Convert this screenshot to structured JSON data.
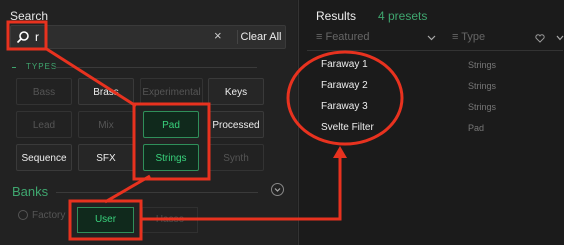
{
  "search": {
    "title": "Search",
    "query": "r",
    "clear_x": "×",
    "clear_all": "Clear All"
  },
  "types": {
    "label": "TYPES",
    "rows": [
      [
        "Bass",
        "Brass",
        "Experimental",
        "Keys"
      ],
      [
        "Lead",
        "Mix",
        "Pad",
        "Processed"
      ],
      [
        "Sequence",
        "SFX",
        "Strings",
        "Synth"
      ]
    ]
  },
  "banks": {
    "label": "Banks",
    "factory": "Factory",
    "user": "User",
    "faded": "Hasso"
  },
  "results": {
    "title": "Results",
    "count": "4 presets",
    "col_featured": "≡ Featured",
    "col_type": "≡ Type",
    "rows": [
      {
        "name": "Faraway 1",
        "type": "Strings"
      },
      {
        "name": "Faraway 2",
        "type": "Strings"
      },
      {
        "name": "Faraway 3",
        "type": "Strings"
      },
      {
        "name": "Svelte Filter",
        "type": "Pad"
      }
    ]
  },
  "colors": {
    "accent": "#3fa66f",
    "highlight": "#e8321f",
    "selected_text": "#39d27c"
  }
}
